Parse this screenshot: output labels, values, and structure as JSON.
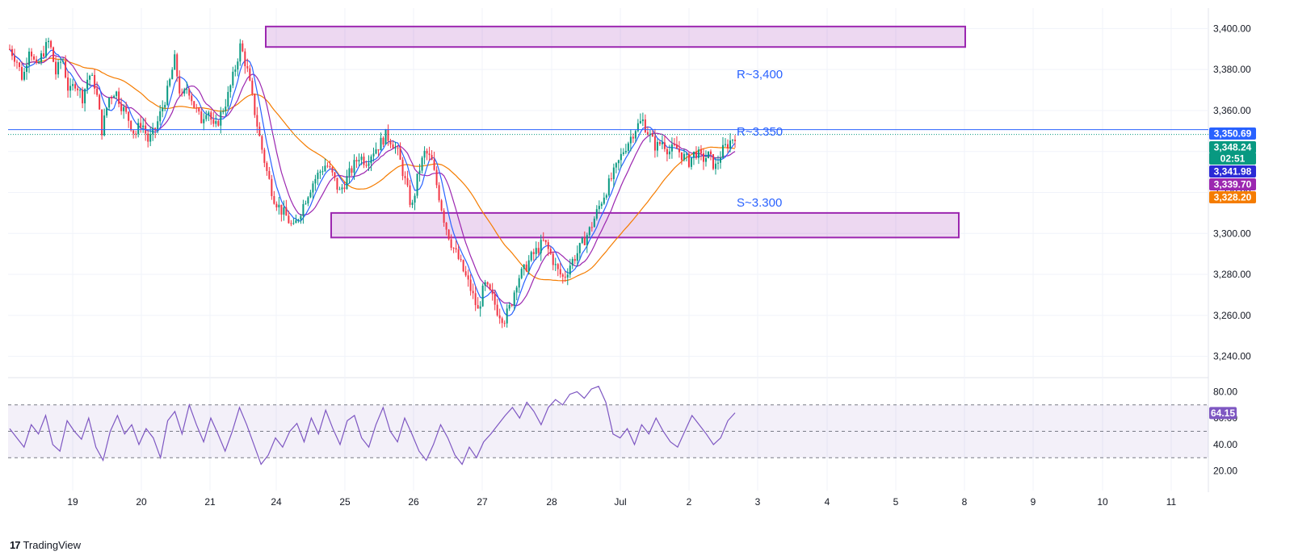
{
  "brand": {
    "logo_mark": "17",
    "name": "TradingView"
  },
  "chart_data": [
    {
      "type": "candlestick",
      "title": "",
      "x_tick_labels": [
        "19",
        "20",
        "21",
        "24",
        "25",
        "26",
        "27",
        "28",
        "Jul",
        "2",
        "3",
        "4",
        "5",
        "8",
        "9",
        "10",
        "11"
      ],
      "ylim": [
        3230,
        3410
      ],
      "y_ticks": [
        3240,
        3260,
        3280,
        3300,
        3320,
        3340,
        3360,
        3380,
        3400
      ],
      "y_tick_labels": [
        "3,240.00",
        "3,260.00",
        "3,280.00",
        "3,300.00",
        "3,320.00",
        "3,340.00",
        "3,360.00",
        "3,380.00",
        "3,400.00"
      ],
      "grid": true,
      "price_path": [
        [
          0,
          3390
        ],
        [
          1,
          3385
        ],
        [
          2,
          3375
        ],
        [
          3,
          3392
        ],
        [
          4,
          3380
        ],
        [
          5,
          3388
        ],
        [
          6,
          3394
        ],
        [
          7,
          3378
        ],
        [
          8,
          3386
        ],
        [
          9,
          3368
        ],
        [
          10,
          3374
        ],
        [
          11,
          3366
        ],
        [
          12,
          3378
        ],
        [
          13,
          3372
        ],
        [
          14,
          3350
        ],
        [
          15,
          3366
        ],
        [
          16,
          3370
        ],
        [
          17,
          3362
        ],
        [
          18,
          3356
        ],
        [
          19,
          3348
        ],
        [
          20,
          3355
        ],
        [
          21,
          3345
        ],
        [
          22,
          3350
        ],
        [
          23,
          3360
        ],
        [
          24,
          3370
        ],
        [
          25,
          3385
        ],
        [
          26,
          3365
        ],
        [
          27,
          3372
        ],
        [
          28,
          3362
        ],
        [
          29,
          3355
        ],
        [
          30,
          3362
        ],
        [
          31,
          3350
        ],
        [
          32,
          3358
        ],
        [
          33,
          3366
        ],
        [
          34,
          3378
        ],
        [
          35,
          3392
        ],
        [
          36,
          3380
        ],
        [
          37,
          3362
        ],
        [
          38,
          3345
        ],
        [
          39,
          3330
        ],
        [
          40,
          3318
        ],
        [
          41,
          3312
        ],
        [
          42,
          3308
        ],
        [
          43,
          3302
        ],
        [
          44,
          3310
        ],
        [
          45,
          3318
        ],
        [
          46,
          3325
        ],
        [
          47,
          3330
        ],
        [
          48,
          3334
        ],
        [
          49,
          3328
        ],
        [
          50,
          3320
        ],
        [
          51,
          3326
        ],
        [
          52,
          3332
        ],
        [
          53,
          3338
        ],
        [
          54,
          3335
        ],
        [
          55,
          3340
        ],
        [
          56,
          3343
        ],
        [
          57,
          3348
        ],
        [
          58,
          3345
        ],
        [
          59,
          3338
        ],
        [
          60,
          3325
        ],
        [
          61,
          3312
        ],
        [
          62,
          3330
        ],
        [
          63,
          3340
        ],
        [
          64,
          3335
        ],
        [
          65,
          3320
        ],
        [
          66,
          3305
        ],
        [
          67,
          3295
        ],
        [
          68,
          3288
        ],
        [
          69,
          3280
        ],
        [
          70,
          3272
        ],
        [
          71,
          3262
        ],
        [
          72,
          3275
        ],
        [
          73,
          3270
        ],
        [
          74,
          3262
        ],
        [
          75,
          3258
        ],
        [
          76,
          3265
        ],
        [
          77,
          3278
        ],
        [
          78,
          3282
        ],
        [
          79,
          3288
        ],
        [
          80,
          3292
        ],
        [
          81,
          3296
        ],
        [
          82,
          3290
        ],
        [
          83,
          3282
        ],
        [
          84,
          3278
        ],
        [
          85,
          3285
        ],
        [
          86,
          3290
        ],
        [
          87,
          3296
        ],
        [
          88,
          3302
        ],
        [
          89,
          3310
        ],
        [
          90,
          3318
        ],
        [
          91,
          3325
        ],
        [
          92,
          3332
        ],
        [
          93,
          3340
        ],
        [
          94,
          3346
        ],
        [
          95,
          3352
        ],
        [
          96,
          3355
        ],
        [
          97,
          3348
        ],
        [
          98,
          3342
        ],
        [
          99,
          3345
        ],
        [
          100,
          3340
        ],
        [
          101,
          3342
        ],
        [
          102,
          3338
        ],
        [
          103,
          3335
        ],
        [
          104,
          3340
        ],
        [
          105,
          3336
        ],
        [
          106,
          3338
        ],
        [
          107,
          3332
        ],
        [
          108,
          3340
        ],
        [
          109,
          3344
        ],
        [
          110,
          3348
        ]
      ],
      "price_path_x_range": [
        0,
        110
      ],
      "zones": [
        {
          "from": 3391,
          "to": 3401,
          "label": "R~3,400"
        },
        {
          "from": 3298,
          "to": 3310,
          "label": "S~3.300"
        }
      ],
      "level_labels": [
        {
          "label": "R~3.350",
          "value": 3350.69
        }
      ],
      "price_badges": [
        {
          "text": "3,350.69",
          "color": "#2962ff"
        },
        {
          "text": "3,348.24",
          "color": "#089981"
        },
        {
          "text": "02:51",
          "color": "#089981"
        },
        {
          "text": "3,341.98",
          "color": "#2a2ad6"
        },
        {
          "text": "3,339.70",
          "color": "#9c27b0"
        },
        {
          "text": "3,328.20",
          "color": "#f57c00"
        }
      ],
      "ma_colors": {
        "fast": "#2962ff",
        "mid": "#9c27b0",
        "slow": "#f57c00"
      },
      "candle_colors": {
        "up": "#089981",
        "down": "#f23645"
      },
      "zone_color": "#9c27b0"
    },
    {
      "type": "line",
      "title": "",
      "series": [
        {
          "values": [
            52,
            45,
            38,
            55,
            48,
            62,
            40,
            35,
            58,
            50,
            44,
            60,
            38,
            28,
            50,
            62,
            48,
            55,
            40,
            52,
            45,
            30,
            58,
            65,
            48,
            70,
            55,
            42,
            60,
            48,
            35,
            50,
            68,
            55,
            40,
            25,
            32,
            45,
            38,
            50,
            56,
            42,
            60,
            48,
            66,
            52,
            40,
            58,
            62,
            45,
            38,
            55,
            68,
            50,
            42,
            60,
            48,
            35,
            28,
            40,
            55,
            45,
            32,
            25,
            38,
            30,
            42,
            48,
            55,
            62,
            68,
            60,
            72,
            65,
            55,
            68,
            74,
            70,
            78,
            80,
            75,
            82,
            84,
            72,
            48,
            45,
            52,
            40,
            55,
            48,
            60,
            50,
            42,
            38,
            50,
            62,
            55,
            48,
            40,
            45,
            58,
            64
          ],
          "color": "#7e57c2"
        }
      ],
      "ylim": [
        10,
        90
      ],
      "y_ticks": [
        20,
        40,
        60,
        80
      ],
      "y_tick_labels": [
        "20.00",
        "40.00",
        "60.00",
        "80.00"
      ],
      "bands": {
        "upper": 70,
        "middle": 50,
        "lower": 30
      },
      "current_value_label": "64.15",
      "current_value_color": "#7e57c2"
    }
  ]
}
